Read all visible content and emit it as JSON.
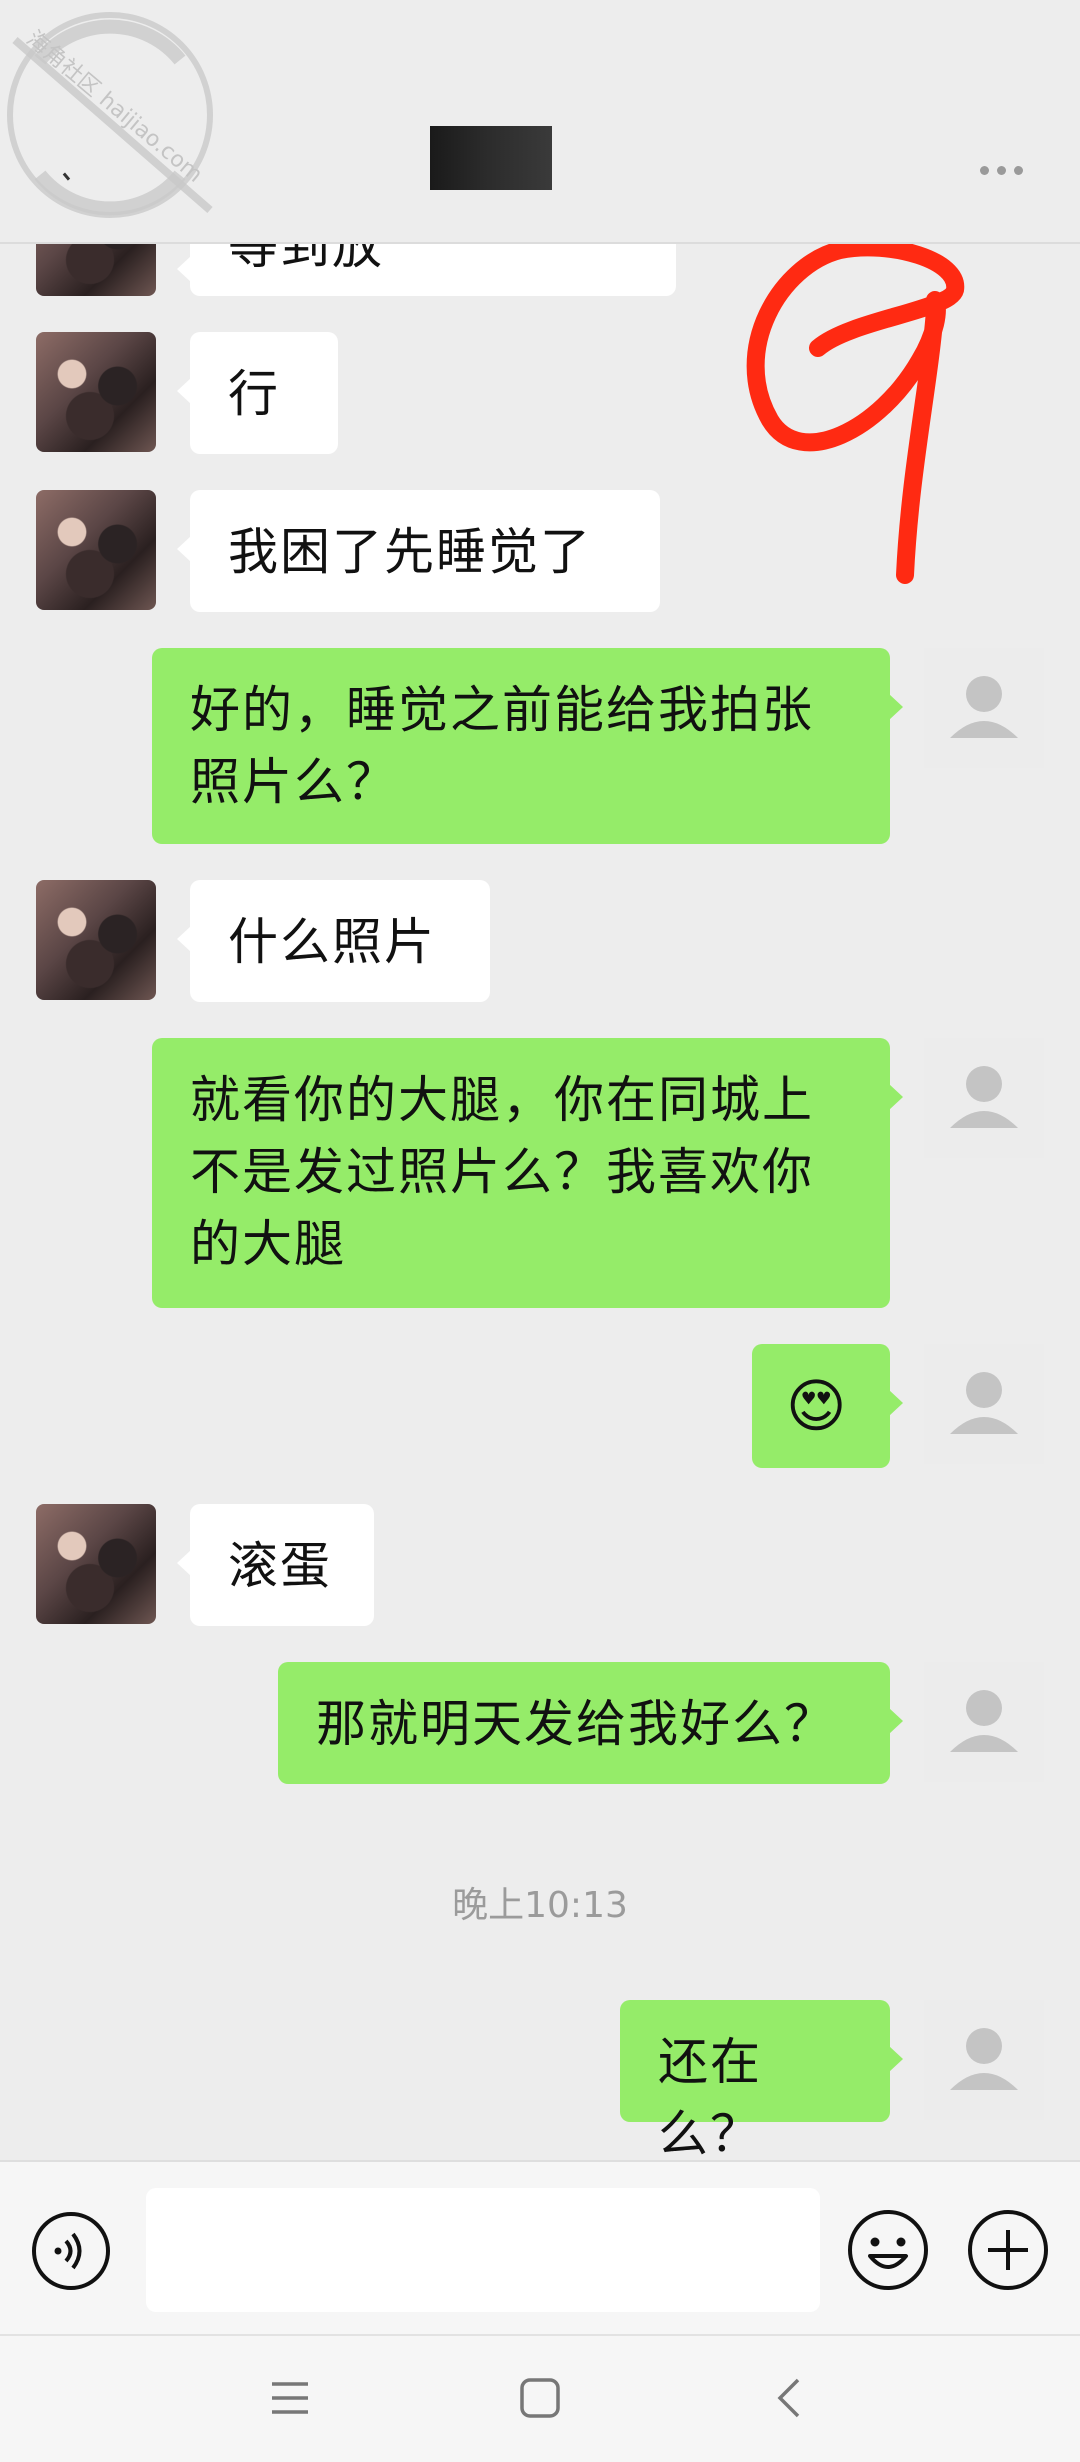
{
  "header": {
    "title": "",
    "watermark_text": "海角社区 haijiao.com"
  },
  "messages": [
    {
      "side": "left",
      "text": "等到放"
    },
    {
      "side": "left",
      "text": "行"
    },
    {
      "side": "left",
      "text": "我困了先睡觉了"
    },
    {
      "side": "right",
      "text": "好的，睡觉之前能给我拍张照片么？"
    },
    {
      "side": "left",
      "text": "什么照片"
    },
    {
      "side": "right",
      "text": "就看你的大腿，你在同城上不是发过照片么？我喜欢你的大腿"
    },
    {
      "side": "right",
      "text": "😍"
    },
    {
      "side": "left",
      "text": "滚蛋"
    },
    {
      "side": "right",
      "text": "那就明天发给我好么？"
    },
    {
      "side": "right",
      "text": "还在么？"
    }
  ],
  "timestamp": "晚上10:13",
  "input": {
    "placeholder": "",
    "voice_icon": "voice-icon",
    "emoji_icon": "emoji-icon",
    "plus_icon": "plus-icon"
  },
  "nav": {
    "menu_icon": "menu-icon",
    "home_icon": "home-icon",
    "back_icon": "back-icon"
  },
  "colors": {
    "background": "#ededed",
    "bubble_right": "#95ec69",
    "bubble_left": "#ffffff",
    "annotation": "#ff2a12"
  }
}
